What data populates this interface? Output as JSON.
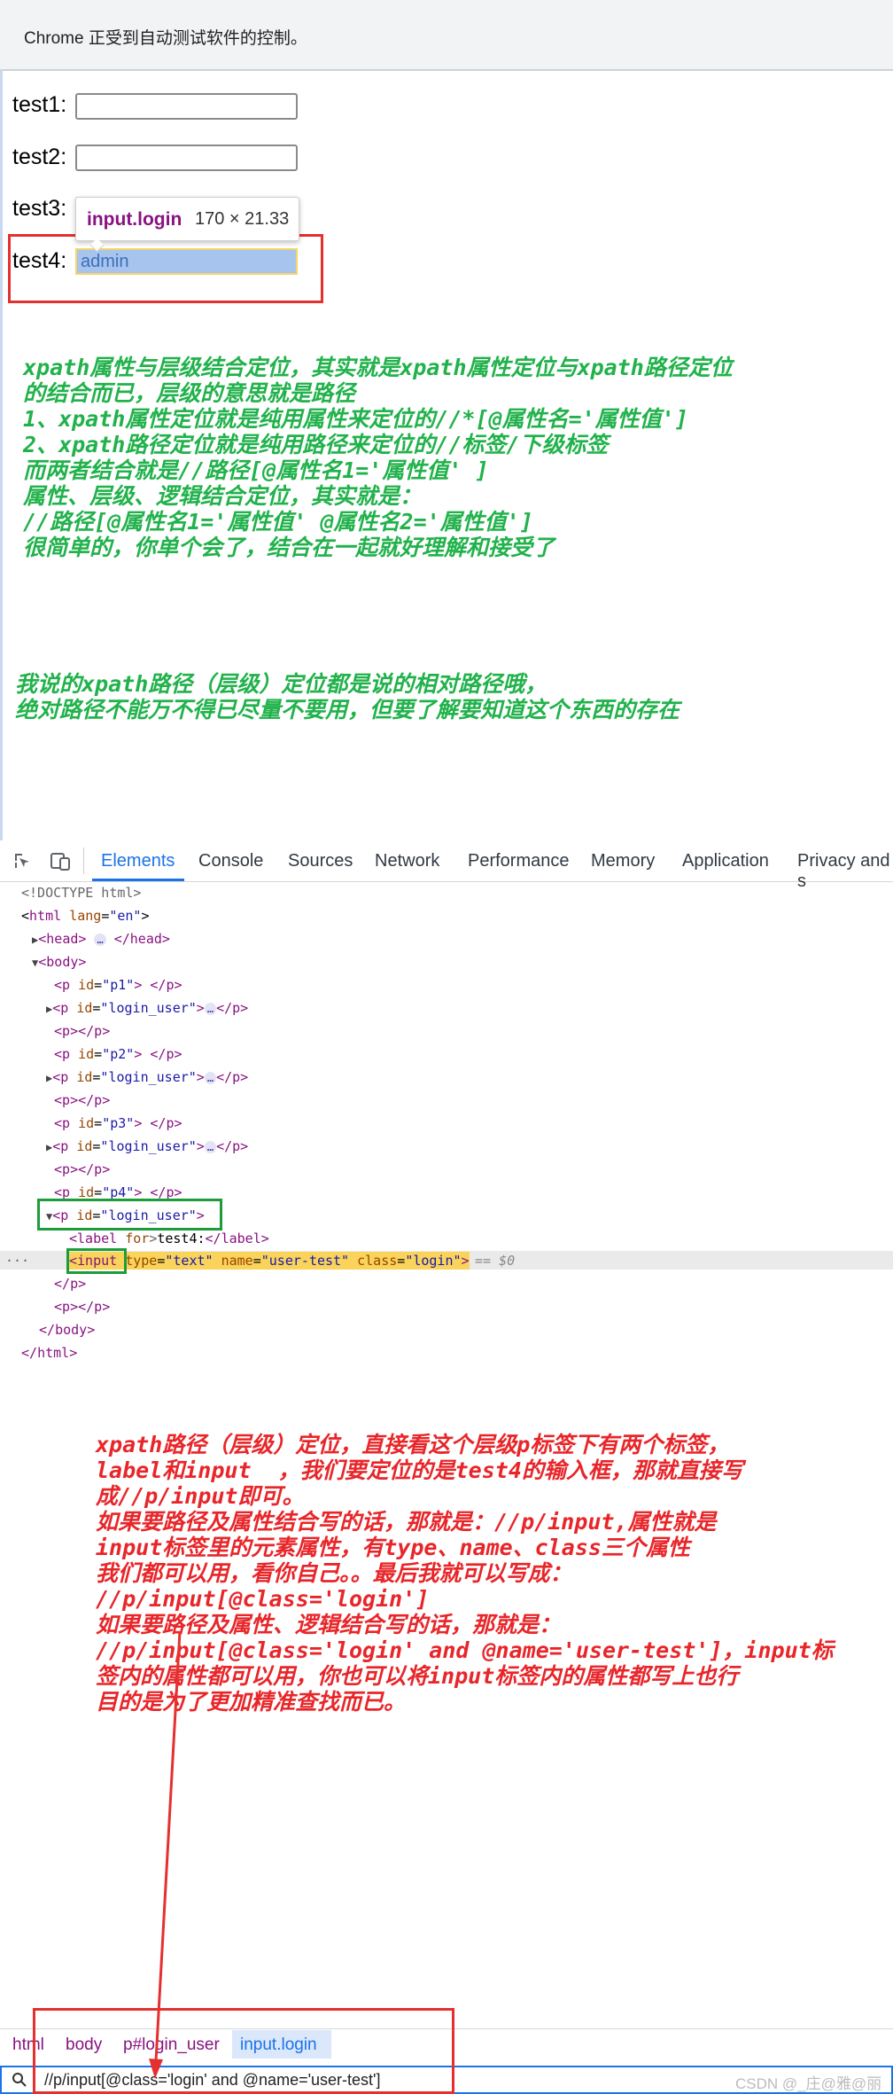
{
  "infobar": {
    "text": "Chrome 正受到自动测试软件的控制。"
  },
  "form": {
    "rows": [
      {
        "label": "test1:",
        "value": ""
      },
      {
        "label": "test2:",
        "value": ""
      },
      {
        "label": "test3:",
        "value": ""
      },
      {
        "label": "test4:",
        "value": "admin"
      }
    ],
    "tooltip": {
      "name": "input.login",
      "size": "170 × 21.33"
    }
  },
  "note_green": {
    "lines": [
      "xpath属性与层级结合定位，其实就是xpath属性定位与xpath路径定位",
      "的结合而已，层级的意思就是路径",
      "1、xpath属性定位就是纯用属性来定位的//*[@属性名='属性值']",
      "2、xpath路径定位就是纯用路径来定位的//标签/下级标签",
      "",
      "而两者结合就是//路径[@属性名1='属性值' ]",
      "",
      "属性、层级、逻辑结合定位，其实就是：",
      "//路径[@属性名1='属性值' @属性名2='属性值']",
      "很简单的，你单个会了，结合在一起就好理解和接受了"
    ],
    "lines2": [
      "我说的xpath路径（层级）定位都是说的相对路径哦，",
      "绝对路径不能万不得已尽量不要用，但要了解要知道这个东西的存在"
    ]
  },
  "devtools": {
    "tabs": [
      "Elements",
      "Console",
      "Sources",
      "Network",
      "Performance",
      "Memory",
      "Application",
      "Privacy and s"
    ],
    "active_tab": "Elements",
    "dom": {
      "doctype": "<!DOCTYPE html>",
      "html_open": "html",
      "lang_attr": "lang",
      "lang_val": "\"en\"",
      "head": "head",
      "body": "body",
      "p": "p",
      "id": "id",
      "p1": "\"p1\"",
      "p2": "\"p2\"",
      "p3": "\"p3\"",
      "p4": "\"p4\"",
      "login_user": "\"login_user\"",
      "label_tag": "label",
      "for_attr": "for",
      "label_text": "test4:",
      "input_tag": "input",
      "type_attr": "type",
      "type_val": "\"text\"",
      "name_attr": "name",
      "name_val": "\"user-test\"",
      "class_attr": "class",
      "class_val": "\"login\"",
      "dollar": "== $0",
      "ellipsis": "…",
      "dots": "···"
    },
    "breadcrumbs": [
      "html",
      "body",
      "p#login_user",
      "input.login"
    ],
    "search": "//p/input[@class='login' and @name='user-test']"
  },
  "note_red": {
    "lines": [
      "xpath路径（层级）定位，直接看这个层级p标签下有两个标签，",
      "label和input  ，我们要定位的是test4的输入框，那就直接写",
      "成//p/input即可。",
      "",
      "如果要路径及属性结合写的话，那就是：//p/input,属性就是",
      "input标签里的元素属性，有type、name、class三个属性",
      "我们都可以用，看你自己。。最后我就可以写成：",
      "//p/input[@class='login']",
      "",
      "如果要路径及属性、逻辑结合写的话，那就是：",
      "//p/input[@class='login' and @name='user-test']，input标",
      "签内的属性都可以用，你也可以将input标签内的属性都写上也行",
      "目的是为了更加精准查找而已。"
    ]
  },
  "watermark": "CSDN @_庄@雅@丽"
}
